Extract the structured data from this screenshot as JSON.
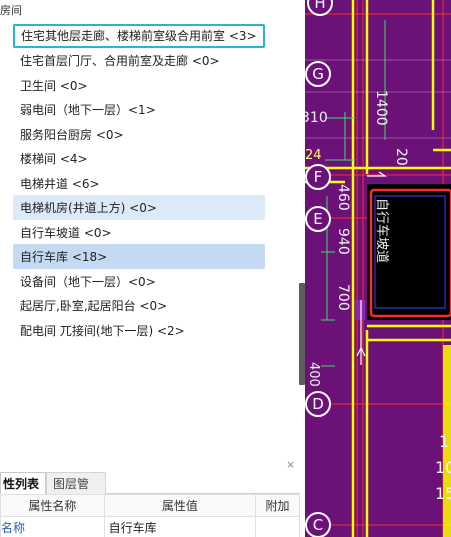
{
  "tree": {
    "header": "房间",
    "items": [
      {
        "label": "住宅其他层走廊、楼梯前室级合用前室 <3>",
        "state": "outlined"
      },
      {
        "label": "住宅首层门厅、合用前室及走廊 <0>",
        "state": "normal"
      },
      {
        "label": "卫生间 <0>",
        "state": "normal"
      },
      {
        "label": "弱电间（地下一层）<1>",
        "state": "normal"
      },
      {
        "label": "服务阳台厨房 <0>",
        "state": "normal"
      },
      {
        "label": "楼梯间 <4>",
        "state": "normal"
      },
      {
        "label": "电梯井道 <6>",
        "state": "normal"
      },
      {
        "label": "电梯机房(井道上方) <0>",
        "state": "hover"
      },
      {
        "label": "自行车坡道 <0>",
        "state": "normal"
      },
      {
        "label": "自行车库 <18>",
        "state": "selected"
      },
      {
        "label": "设备间（地下一层）<0>",
        "state": "normal"
      },
      {
        "label": "起居厅,卧室,起居阳台 <0>",
        "state": "normal"
      },
      {
        "label": "配电间 兀接间(地下一层) <2>",
        "state": "normal"
      }
    ]
  },
  "panel": {
    "close_glyph": "×",
    "tabs": [
      {
        "label": "性列表",
        "active": true
      },
      {
        "label": "图层管理",
        "active": false
      }
    ],
    "table": {
      "headers": [
        "属性名称",
        "属性值",
        "附加"
      ],
      "rows": [
        {
          "name": "名称",
          "value": "自行车库",
          "extra": ""
        }
      ]
    }
  },
  "cad": {
    "axis_labels": [
      "H",
      "G",
      "F",
      "E",
      "D",
      "C"
    ],
    "dimensions": [
      "1400",
      "20",
      "310",
      "24",
      "460",
      "940",
      "700",
      "400"
    ],
    "room_text": "自行车坡道",
    "partial_text": [
      "1",
      "10",
      "15"
    ],
    "colors": {
      "background": "#6b1178",
      "wall": "#ffff00",
      "grid": "#ff2a2a",
      "dimension": "#3ee06a",
      "highlight": "#ff2b2b"
    }
  }
}
